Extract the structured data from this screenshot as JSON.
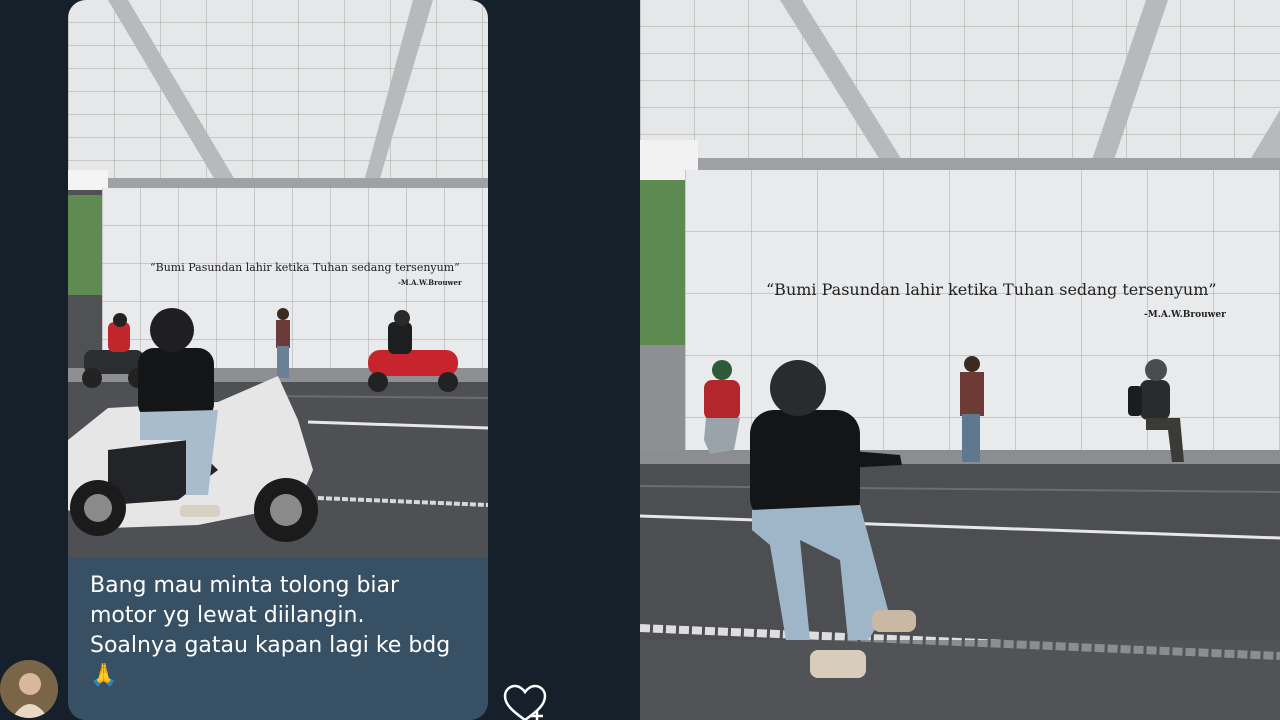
{
  "wall": {
    "quote": "“Bumi Pasundan lahir ketika Tuhan sedang tersenyum”",
    "author": "-M.A.W.Brouwer"
  },
  "message": {
    "line1": "Bang mau minta tolong biar",
    "line2": "motor yg lewat diilangin.",
    "line3": "Soalnya gatau kapan lagi ke bdg",
    "emoji": "🙏"
  },
  "icons": {
    "like": "heart-plus-icon",
    "avatar": "user-avatar"
  },
  "colors": {
    "background": "#15202b",
    "bubble": "#385064",
    "text": "#ffffff"
  }
}
